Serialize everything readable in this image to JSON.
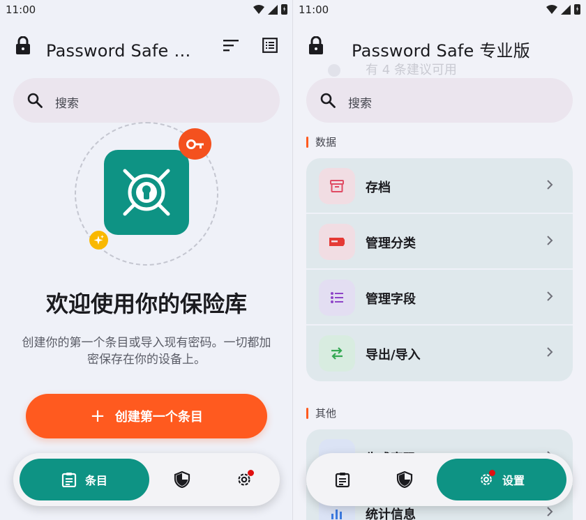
{
  "status_bar": {
    "time": "11:00"
  },
  "left": {
    "title": "Password Safe 专业版",
    "search": {
      "placeholder": "搜索"
    },
    "welcome": {
      "title": "欢迎使用你的保险库",
      "description": "创建你的第一个条目或导入现有密码。一切都加密保存在你的设备上。"
    },
    "create_button": {
      "icon": "plus-icon",
      "label": "创建第一个条目"
    },
    "nav": {
      "entries_label": "条目"
    }
  },
  "right": {
    "title": "Password Safe 专业版",
    "ghost_text": "有 4 条建议可用",
    "search": {
      "placeholder": "搜索"
    },
    "sections": [
      {
        "title": "数据",
        "items": [
          {
            "label": "存档",
            "icon": "archive-icon",
            "tile": "#f1dde3",
            "color": "#e04a63"
          },
          {
            "label": "管理分类",
            "icon": "tag-icon",
            "tile": "#f1dde3",
            "color": "#e53935"
          },
          {
            "label": "管理字段",
            "icon": "bullet-list-icon",
            "tile": "#e3def2",
            "color": "#8e44c8"
          },
          {
            "label": "导出/导入",
            "icon": "swap-arrows-icon",
            "tile": "#d8ece0",
            "color": "#34a853"
          }
        ]
      },
      {
        "title": "其他",
        "items": [
          {
            "label": "生成密码",
            "icon": "generator-icon",
            "tile": "#dbe3f5",
            "color": "#3d7be0"
          },
          {
            "label": "统计信息",
            "icon": "bar-chart-icon",
            "tile": "#dbe3f5",
            "color": "#3d7be0"
          }
        ]
      }
    ],
    "nav": {
      "settings_label": "设置"
    }
  },
  "colors": {
    "accent": "#0e9384",
    "primary_action": "#ff5a1f",
    "notification": "#e01010"
  }
}
